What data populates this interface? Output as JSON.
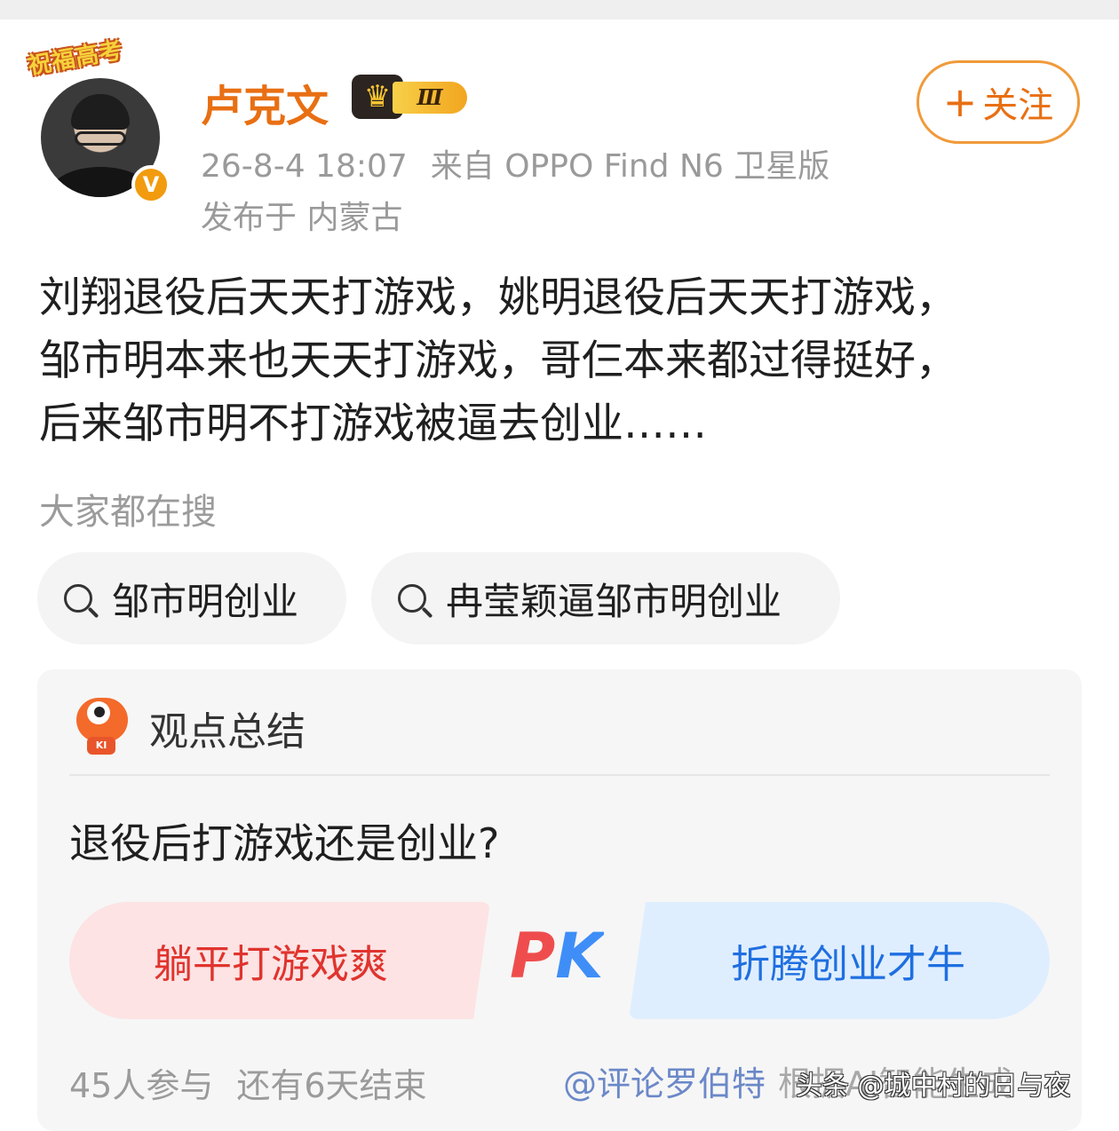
{
  "post": {
    "avatar_badge": "祝福高考",
    "verified_mark": "V",
    "username": "卢克文",
    "level_badge": "Ⅲ",
    "timestamp": "26-8-4 18:07",
    "source": "来自 OPPO Find N6 卫星版",
    "location": "发布于 内蒙古",
    "follow": {
      "plus": "+",
      "label": "关注"
    },
    "content_lines": [
      "刘翔退役后天天打游戏，姚明退役后天天打游戏，",
      "邹市明本来也天天打游戏，哥仨本来都过得挺好，",
      "后来邹市明不打游戏被逼去创业……"
    ]
  },
  "search": {
    "title": "大家都在搜",
    "chips": [
      "邹市明创业",
      "冉莹颖逼邹市明创业"
    ]
  },
  "summary_card": {
    "title": "观点总结",
    "robot_label": "KI",
    "question": "退役后打游戏还是创业?",
    "option_left": "躺平打游戏爽",
    "pk_label": "PK",
    "option_right": "折腾创业才牛",
    "participants": "45人参与",
    "remaining": "还有6天结束",
    "attribution": "@评论罗伯特",
    "attribution_suffix": "根据AI智能生成"
  },
  "watermark": "头条 @城中村的日与夜",
  "colors": {
    "username_orange": "#e86f13",
    "follow_border": "#f09a3a",
    "pk_red": "#e0342e",
    "pk_blue": "#1f6fe0",
    "meta_gray": "#9a9a9a"
  }
}
